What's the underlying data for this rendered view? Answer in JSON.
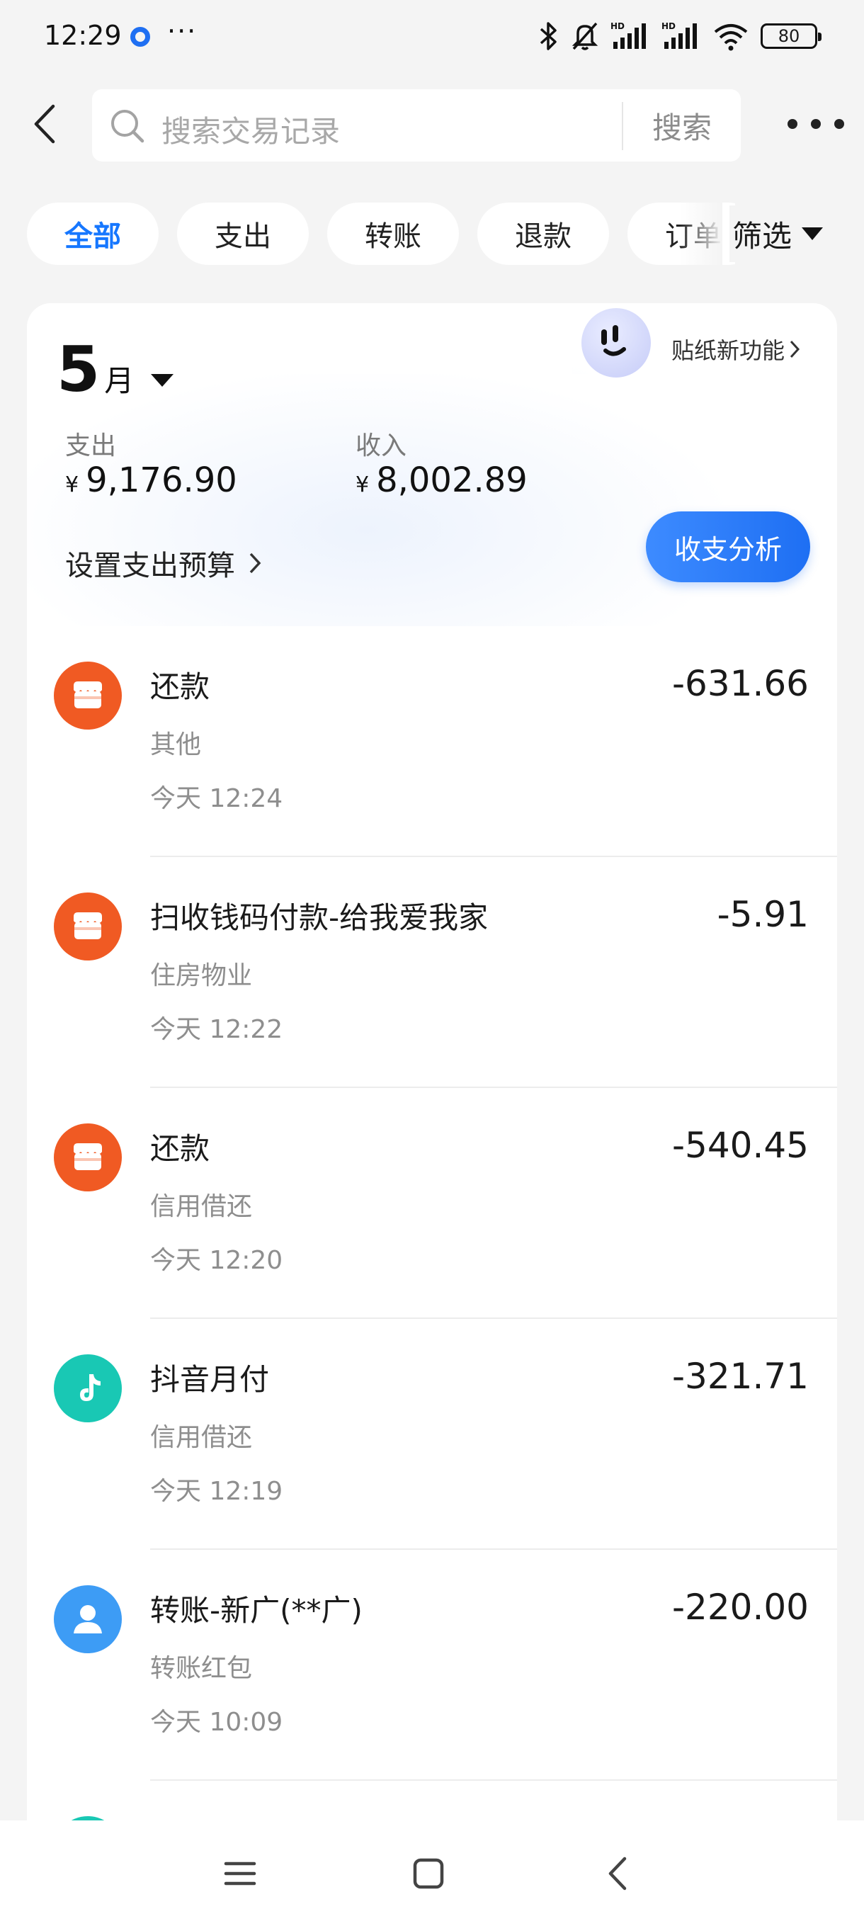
{
  "status_bar": {
    "time": "12:29",
    "more": "···",
    "battery": "80"
  },
  "header": {
    "search": {
      "placeholder": "搜索交易记录",
      "button_label": "搜索"
    }
  },
  "filters": {
    "chips": [
      "全部",
      "支出",
      "转账",
      "退款",
      "订单"
    ],
    "active_index": 0,
    "filter_label": "筛选"
  },
  "summary": {
    "sticker_label": "贴纸新功能",
    "month_number": "5",
    "month_unit": "月",
    "expense_label": "支出",
    "expense_value": "9,176.90",
    "income_label": "收入",
    "income_value": "8,002.89",
    "currency": "¥",
    "budget_link": "设置支出预算",
    "analysis_button": "收支分析"
  },
  "transactions": [
    {
      "title": "还款",
      "category": "其他",
      "time": "今天 12:24",
      "amount": "-631.66",
      "icon": "store-icon",
      "icon_color": "#f05a23"
    },
    {
      "title": "扫收钱码付款-给我爱我家",
      "category": "住房物业",
      "time": "今天 12:22",
      "amount": "-5.91",
      "icon": "store-icon",
      "icon_color": "#f05a23"
    },
    {
      "title": "还款",
      "category": "信用借还",
      "time": "今天 12:20",
      "amount": "-540.45",
      "icon": "store-icon",
      "icon_color": "#f05a23"
    },
    {
      "title": "抖音月付",
      "category": "信用借还",
      "time": "今天 12:19",
      "amount": "-321.71",
      "icon": "music-note-icon",
      "icon_color": "#19c8b4"
    },
    {
      "title": "转账-新广(**广)",
      "category": "转账红包",
      "time": "今天 10:09",
      "amount": "-220.00",
      "icon": "person-icon",
      "icon_color": "#3d9cf5"
    }
  ],
  "colors": {
    "accent": "#1677ff",
    "background": "#f4f4f4",
    "merchant_orange": "#f05a23",
    "douyin_teal": "#19c8b4",
    "transfer_blue": "#3d9cf5"
  }
}
